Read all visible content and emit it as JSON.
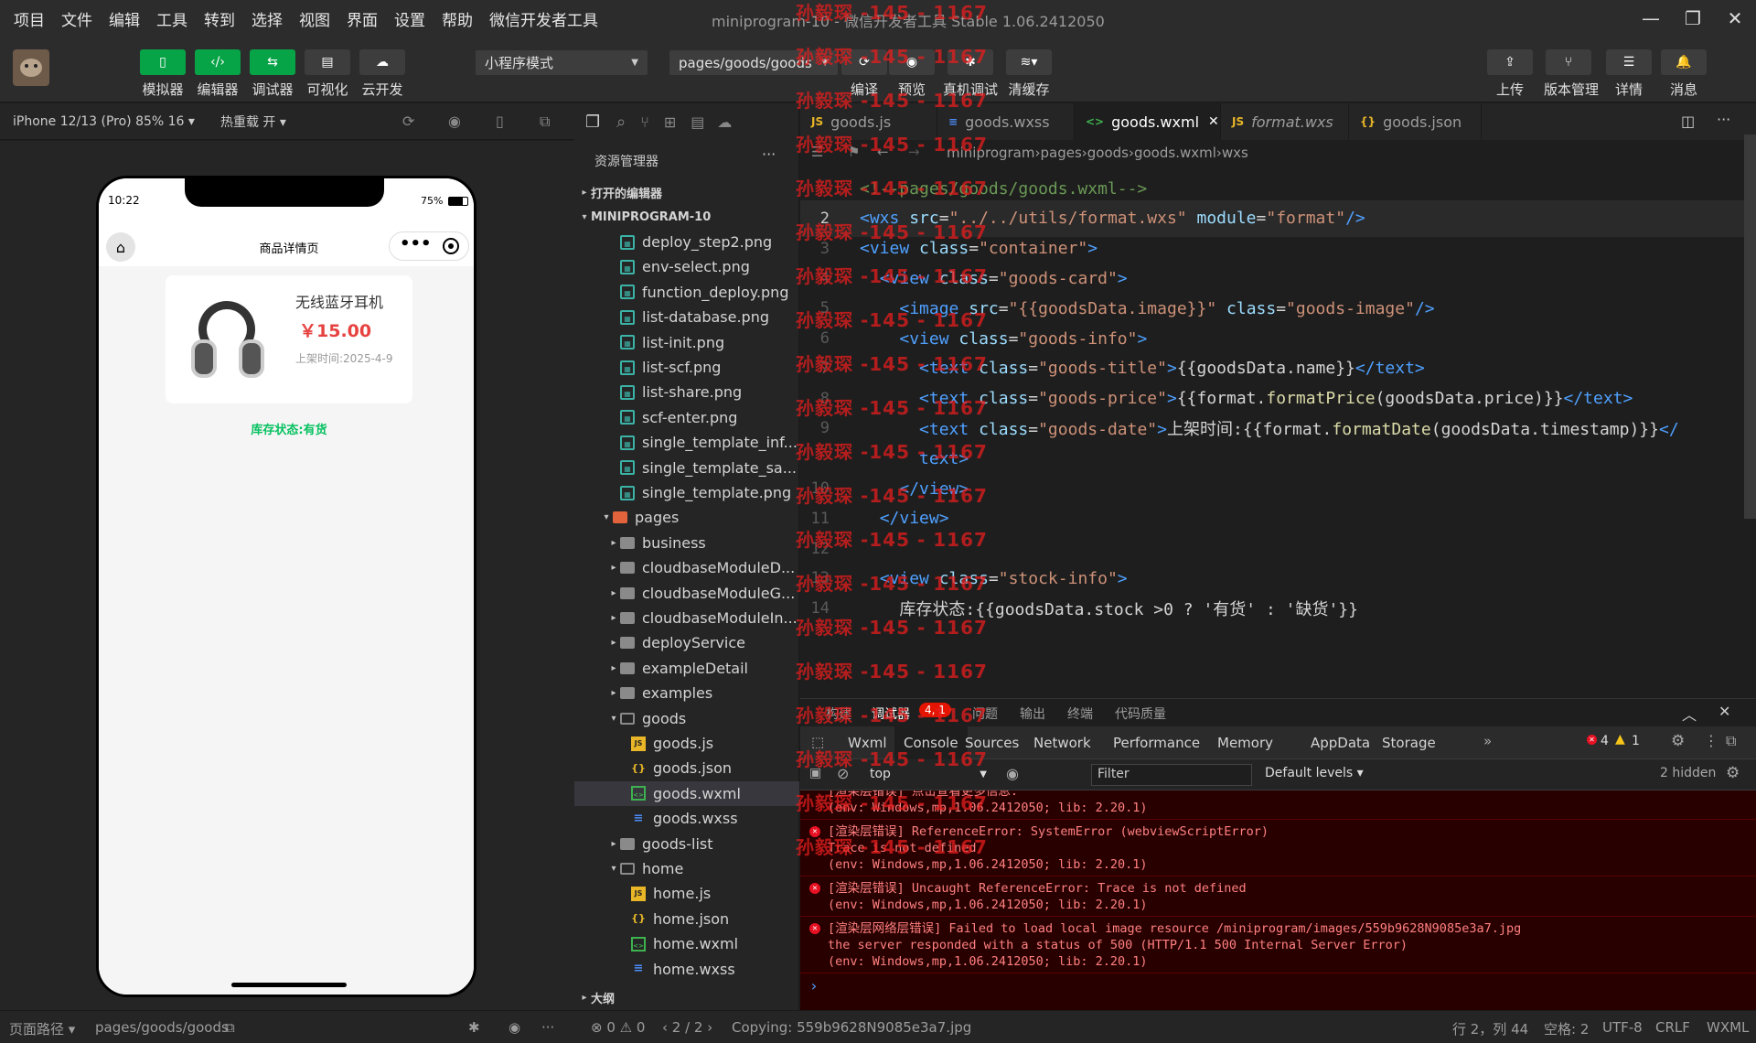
{
  "menubar": {
    "items": [
      "项目",
      "文件",
      "编辑",
      "工具",
      "转到",
      "选择",
      "视图",
      "界面",
      "设置",
      "帮助",
      "微信开发者工具"
    ],
    "title": "miniprogram-10 - 微信开发者工具 Stable 1.06.2412050"
  },
  "toolbar": {
    "buttons": [
      "模拟器",
      "编辑器",
      "调试器",
      "可视化",
      "云开发"
    ],
    "mode": "小程序模式",
    "page_path": "pages/goods/goods",
    "actions": [
      "编译",
      "预览",
      "真机调试",
      "清缓存"
    ],
    "right": [
      "上传",
      "版本管理",
      "详情",
      "消息"
    ]
  },
  "simulator": {
    "device": "iPhone 12/13 (Pro) 85% 16",
    "hot_reload": "热重载 开",
    "time": "10:22",
    "battery": "75%",
    "nav_title": "商品详情页",
    "product_name": "无线蓝牙耳机",
    "price": "￥15.00",
    "date": "上架时间:2025-4-9",
    "stock": "库存状态:有货"
  },
  "explorer": {
    "title": "资源管理器",
    "open_editors": "打开的编辑器",
    "project": "MINIPROGRAM-10",
    "files": [
      {
        "name": "deploy_step2.png",
        "type": "png",
        "depth": 2
      },
      {
        "name": "env-select.png",
        "type": "png",
        "depth": 2
      },
      {
        "name": "function_deploy.png",
        "type": "png",
        "depth": 2
      },
      {
        "name": "list-database.png",
        "type": "png",
        "depth": 2
      },
      {
        "name": "list-init.png",
        "type": "png",
        "depth": 2
      },
      {
        "name": "list-scf.png",
        "type": "png",
        "depth": 2
      },
      {
        "name": "list-share.png",
        "type": "png",
        "depth": 2
      },
      {
        "name": "scf-enter.png",
        "type": "png",
        "depth": 2
      },
      {
        "name": "single_template_inf...",
        "type": "png",
        "depth": 2
      },
      {
        "name": "single_template_sa...",
        "type": "png",
        "depth": 2
      },
      {
        "name": "single_template.png",
        "type": "png",
        "depth": 2
      },
      {
        "name": "pages",
        "type": "pages",
        "depth": 1,
        "arrow": "▾"
      },
      {
        "name": "business",
        "type": "folder",
        "depth": 2,
        "arrow": "▸"
      },
      {
        "name": "cloudbaseModuleD...",
        "type": "folder",
        "depth": 2,
        "arrow": "▸"
      },
      {
        "name": "cloudbaseModuleG...",
        "type": "folder",
        "depth": 2,
        "arrow": "▸"
      },
      {
        "name": "cloudbaseModuleIn...",
        "type": "folder",
        "depth": 2,
        "arrow": "▸"
      },
      {
        "name": "deployService",
        "type": "folder",
        "depth": 2,
        "arrow": "▸"
      },
      {
        "name": "exampleDetail",
        "type": "folder",
        "depth": 2,
        "arrow": "▸"
      },
      {
        "name": "examples",
        "type": "folder",
        "depth": 2,
        "arrow": "▸"
      },
      {
        "name": "goods",
        "type": "folderopen",
        "depth": 2,
        "arrow": "▾"
      },
      {
        "name": "goods.js",
        "type": "js",
        "depth": 3
      },
      {
        "name": "goods.json",
        "type": "json",
        "depth": 3
      },
      {
        "name": "goods.wxml",
        "type": "wxml",
        "depth": 3,
        "selected": true
      },
      {
        "name": "goods.wxss",
        "type": "wxss",
        "depth": 3
      },
      {
        "name": "goods-list",
        "type": "folder",
        "depth": 2,
        "arrow": "▸"
      },
      {
        "name": "home",
        "type": "folderopen",
        "depth": 2,
        "arrow": "▾"
      },
      {
        "name": "home.js",
        "type": "js",
        "depth": 3
      },
      {
        "name": "home.json",
        "type": "json",
        "depth": 3
      },
      {
        "name": "home.wxml",
        "type": "wxml",
        "depth": 3
      },
      {
        "name": "home.wxss",
        "type": "wxss",
        "depth": 3
      }
    ],
    "outline": "大纲"
  },
  "editor": {
    "tabs": [
      {
        "name": "goods.js",
        "icon": "JS"
      },
      {
        "name": "goods.wxss",
        "icon": "≡"
      },
      {
        "name": "goods.wxml",
        "icon": "<>",
        "active": true
      },
      {
        "name": "format.wxs",
        "icon": "JS"
      },
      {
        "name": "goods.json",
        "icon": "{}"
      }
    ],
    "breadcrumb": [
      "miniprogram",
      "pages",
      "goods",
      "goods.wxml",
      "wxs"
    ],
    "lines": [
      {
        "n": "",
        "html": "<span class='t-com'>&lt;!--pages/goods/goods.wxml--&gt;</span>"
      },
      {
        "n": "2",
        "html": "<span class='t-tag'>&lt;wxs</span> <span class='t-attr'>src</span><span class='t-txt'>=</span><span class='t-str'>\"../../utils/format.wxs\"</span> <span class='t-attr'>module</span><span class='t-txt'>=</span><span class='t-str'>\"format\"</span><span class='t-tag'>/&gt;</span>"
      },
      {
        "n": "3",
        "html": "<span class='t-tag'>&lt;view</span> <span class='t-attr'>class</span><span class='t-txt'>=</span><span class='t-str'>\"container\"</span><span class='t-tag'>&gt;</span>"
      },
      {
        "n": "4",
        "html": "&nbsp;&nbsp;<span class='t-tag'>&lt;view</span> <span class='t-attr'>class</span><span class='t-txt'>=</span><span class='t-str'>\"goods-card\"</span><span class='t-tag'>&gt;</span>"
      },
      {
        "n": "5",
        "html": "&nbsp;&nbsp;&nbsp;&nbsp;<span class='t-tag'>&lt;image</span> <span class='t-attr'>src</span><span class='t-txt'>=</span><span class='t-str'>\"{{goodsData.image}}\"</span> <span class='t-attr'>class</span><span class='t-txt'>=</span><span class='t-str'>\"goods-image\"</span><span class='t-tag'>/&gt;</span>"
      },
      {
        "n": "6",
        "html": "&nbsp;&nbsp;&nbsp;&nbsp;<span class='t-tag'>&lt;view</span> <span class='t-attr'>class</span><span class='t-txt'>=</span><span class='t-str'>\"goods-info\"</span><span class='t-tag'>&gt;</span>"
      },
      {
        "n": "7",
        "html": "&nbsp;&nbsp;&nbsp;&nbsp;&nbsp;&nbsp;<span class='t-tag'>&lt;text</span> <span class='t-attr'>class</span><span class='t-txt'>=</span><span class='t-str'>\"goods-title\"</span><span class='t-tag'>&gt;</span><span class='t-txt'>{{goodsData.name}}</span><span class='t-tag'>&lt;/text&gt;</span>"
      },
      {
        "n": "8",
        "html": "&nbsp;&nbsp;&nbsp;&nbsp;&nbsp;&nbsp;<span class='t-tag'>&lt;text</span> <span class='t-attr'>class</span><span class='t-txt'>=</span><span class='t-str'>\"goods-price\"</span><span class='t-tag'>&gt;</span><span class='t-txt'>{{format.</span><span class='t-fn'>formatPrice</span><span class='t-txt'>(goodsData.price)}}</span><span class='t-tag'>&lt;/text&gt;</span>"
      },
      {
        "n": "9",
        "html": "&nbsp;&nbsp;&nbsp;&nbsp;&nbsp;&nbsp;<span class='t-tag'>&lt;text</span> <span class='t-attr'>class</span><span class='t-txt'>=</span><span class='t-str'>\"goods-date\"</span><span class='t-tag'>&gt;</span><span class='t-txt'>上架时间:{{format.</span><span class='t-fn'>formatDate</span><span class='t-txt'>(goodsData.timestamp)}}</span><span class='t-tag'>&lt;/</span>"
      },
      {
        "n": "",
        "html": "&nbsp;&nbsp;&nbsp;&nbsp;&nbsp;&nbsp;<span class='t-tag'>text&gt;</span>"
      },
      {
        "n": "10",
        "html": "&nbsp;&nbsp;&nbsp;&nbsp;<span class='t-tag'>&lt;/view&gt;</span>"
      },
      {
        "n": "11",
        "html": "&nbsp;&nbsp;<span class='t-tag'>&lt;/view&gt;</span>"
      },
      {
        "n": "12",
        "html": ""
      },
      {
        "n": "13",
        "html": "&nbsp;&nbsp;<span class='t-tag'>&lt;view</span> <span class='t-attr'>class</span><span class='t-txt'>=</span><span class='t-str'>\"stock-info\"</span><span class='t-tag'>&gt;</span>"
      },
      {
        "n": "14",
        "html": "&nbsp;&nbsp;&nbsp;&nbsp;<span class='t-txt'>库存状态:{{goodsData.stock &gt;0 ? '有货' : '缺货'}}</span>"
      }
    ]
  },
  "panel": {
    "tabs": [
      "构建",
      "调试器",
      "问题",
      "输出",
      "终端",
      "代码质量"
    ],
    "badge": "4, 1",
    "devtabs": [
      "Wxml",
      "Console",
      "Sources",
      "Network",
      "Performance",
      "Memory",
      "AppData",
      "Storage"
    ],
    "err_count": "4",
    "warn_count": "1",
    "context": "top",
    "filter_placeholder": "Filter",
    "levels": "Default levels",
    "hidden": "2 hidden",
    "messages": [
      {
        "lines": [
          "[渲染层错误] 点击查看更多信息:",
          "(env: Windows,mp,1.06.2412050; lib: 2.20.1)"
        ]
      },
      {
        "lines": [
          "[渲染层错误] ReferenceError: SystemError (webviewScriptError)",
          "Trace is not defined",
          "(env: Windows,mp,1.06.2412050; lib: 2.20.1)"
        ]
      },
      {
        "lines": [
          "[渲染层错误] Uncaught ReferenceError: Trace is not defined",
          "(env: Windows,mp,1.06.2412050; lib: 2.20.1)"
        ]
      },
      {
        "lines": [
          "[渲染层网络层错误] Failed to load local image resource /miniprogram/images/559b9628N9085e3a7.jpg",
          " the server responded with a status of 500 (HTTP/1.1 500 Internal Server Error)",
          "(env: Windows,mp,1.06.2412050; lib: 2.20.1)"
        ]
      }
    ]
  },
  "statusbar": {
    "path_label": "页面路径",
    "path": "pages/goods/goods",
    "errors": "0",
    "warnings": "0",
    "nav": "2 / 2",
    "copying": "Copying: 559b9628N9085e3a7.jpg",
    "position": "行 2，列 44",
    "spaces": "空格: 2",
    "encoding": "UTF-8",
    "eol": "CRLF",
    "lang": "WXML"
  },
  "watermark": "孙毅琛 -145 - 1167"
}
